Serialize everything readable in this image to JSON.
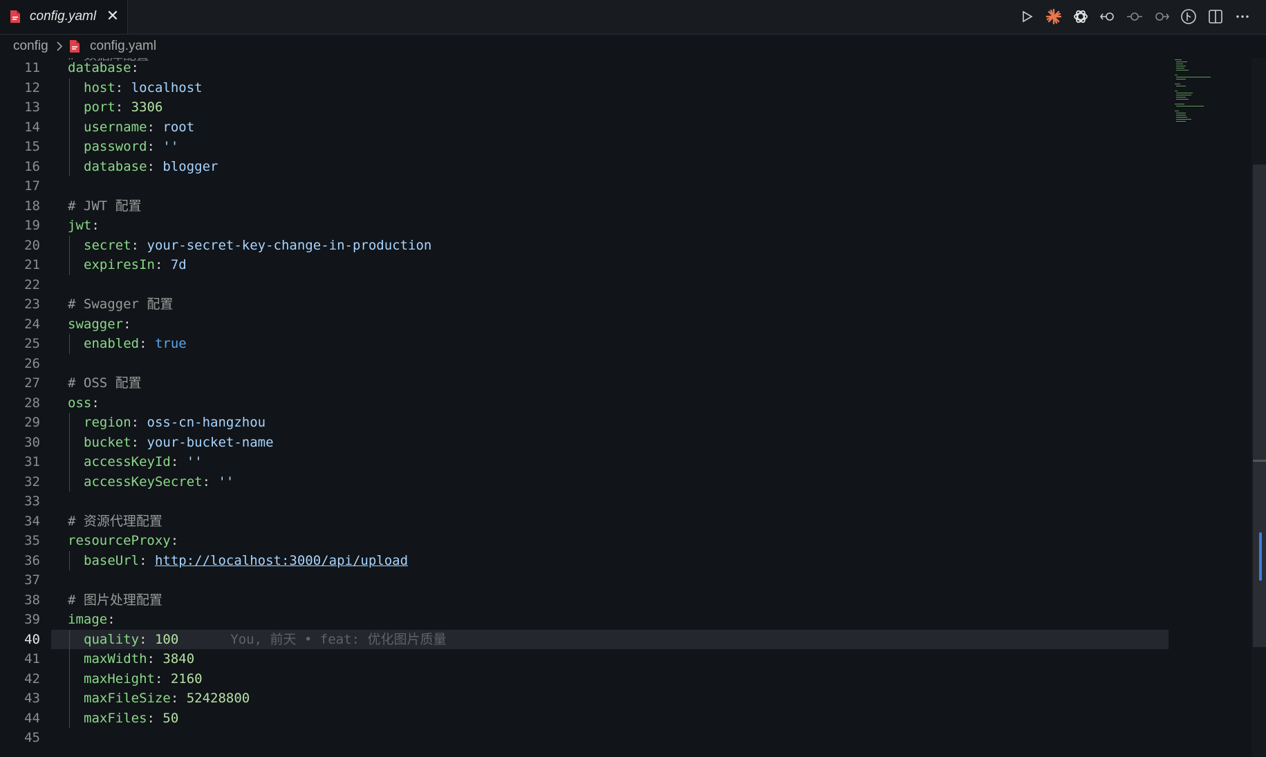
{
  "tab": {
    "title": "config.yaml",
    "close": "✕"
  },
  "toolbar": {
    "icons": [
      "run-icon",
      "claude-icon",
      "openai-icon",
      "go-back-icon",
      "commit-icon",
      "go-forward-icon",
      "git-graph-icon",
      "split-editor-icon",
      "more-icon"
    ]
  },
  "breadcrumb": {
    "folder": "config",
    "file": "config.yaml"
  },
  "editor": {
    "partial_top": "# 数据库配置",
    "active_line": 40,
    "lines": [
      {
        "n": "11"
      },
      {
        "n": "12"
      },
      {
        "n": "13"
      },
      {
        "n": "14"
      },
      {
        "n": "15"
      },
      {
        "n": "16"
      },
      {
        "n": "17"
      },
      {
        "n": "18"
      },
      {
        "n": "19"
      },
      {
        "n": "20"
      },
      {
        "n": "21"
      },
      {
        "n": "22"
      },
      {
        "n": "23"
      },
      {
        "n": "24"
      },
      {
        "n": "25"
      },
      {
        "n": "26"
      },
      {
        "n": "27"
      },
      {
        "n": "28"
      },
      {
        "n": "29"
      },
      {
        "n": "30"
      },
      {
        "n": "31"
      },
      {
        "n": "32"
      },
      {
        "n": "33"
      },
      {
        "n": "34"
      },
      {
        "n": "35"
      },
      {
        "n": "36"
      },
      {
        "n": "37"
      },
      {
        "n": "38"
      },
      {
        "n": "39"
      },
      {
        "n": "40"
      },
      {
        "n": "41"
      },
      {
        "n": "42"
      },
      {
        "n": "43"
      },
      {
        "n": "44"
      },
      {
        "n": "45"
      }
    ],
    "code": {
      "l11_key": "database",
      "l11_colon": ":",
      "l12_key": "host",
      "l12_val": "localhost",
      "l13_key": "port",
      "l13_val": "3306",
      "l14_key": "username",
      "l14_val": "root",
      "l15_key": "password",
      "l15_val": "''",
      "l16_key": "database",
      "l16_val": "blogger",
      "l18_comment": "# JWT 配置",
      "l19_key": "jwt",
      "l20_key": "secret",
      "l20_val": "your-secret-key-change-in-production",
      "l21_key": "expiresIn",
      "l21_val": "7d",
      "l23_comment": "# Swagger 配置",
      "l24_key": "swagger",
      "l25_key": "enabled",
      "l25_val": "true",
      "l27_comment": "# OSS 配置",
      "l28_key": "oss",
      "l29_key": "region",
      "l29_val": "oss-cn-hangzhou",
      "l30_key": "bucket",
      "l30_val": "your-bucket-name",
      "l31_key": "accessKeyId",
      "l31_val": "''",
      "l32_key": "accessKeySecret",
      "l32_val": "''",
      "l34_comment": "# 资源代理配置",
      "l35_key": "resourceProxy",
      "l36_key": "baseUrl",
      "l36_val": "http://localhost:3000/api/upload",
      "l38_comment": "# 图片处理配置",
      "l39_key": "image",
      "l40_key": "quality",
      "l40_val": "100",
      "l40_blame": "You, 前天 • feat: 优化图片质量",
      "l41_key": "maxWidth",
      "l41_val": "3840",
      "l42_key": "maxHeight",
      "l42_val": "2160",
      "l43_key": "maxFileSize",
      "l43_val": "52428800",
      "l44_key": "maxFiles",
      "l44_val": "50"
    }
  }
}
